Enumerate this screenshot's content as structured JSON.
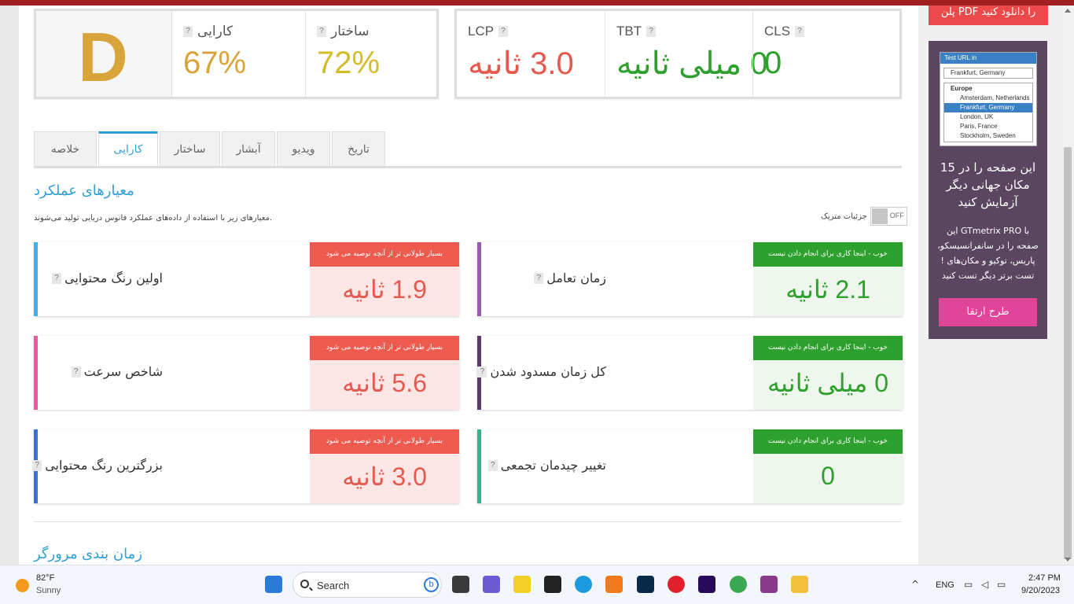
{
  "summary": {
    "grade": "D",
    "performance": {
      "label": "کارایی",
      "value": "67%",
      "color": "#d9a43a"
    },
    "structure": {
      "label": "ساختار",
      "value": "72%",
      "color": "#d4bb2a"
    }
  },
  "vitals": {
    "lcp": {
      "label": "LCP",
      "value": "3.0 ثانیه",
      "color": "#e55a4f"
    },
    "tbt": {
      "label": "TBT",
      "value": "0 میلی ثانیه",
      "color": "#2ea02e"
    },
    "cls": {
      "label": "CLS",
      "value": "0",
      "color": "#2ea02e"
    }
  },
  "help_mark": "?",
  "tabs": [
    "خلاصه",
    "کارایی",
    "ساختار",
    "آبشار",
    "ویدیو",
    "تاریخ"
  ],
  "active_tab": "کارایی",
  "metrics_section": {
    "title": "معیارهای عملکرد",
    "description": ".معیارهای زیر با استفاده از داده‌های عملکرد فانوس دریایی تولید می‌شوند",
    "toggle_label": "جزئیات متریک",
    "toggle_state": "OFF"
  },
  "metrics": [
    {
      "label": "زمان تعامل",
      "status": "خوب - اینجا کاری برای انجام دادن نیست",
      "value": "2.1 ثانیه",
      "type": "good",
      "bar_color": "#9b59b6"
    },
    {
      "label": "اولین رنگ محتوایی",
      "status": "بسیار طولانی تر از آنچه توصیه می شود",
      "value": "1.9 ثانیه",
      "type": "bad",
      "bar_color": "#35b5e8"
    },
    {
      "label": "کل زمان مسدود شدن",
      "status": "خوب - اینجا کاری برای انجام دادن نیست",
      "value": "0 میلی ثانیه",
      "type": "good",
      "bar_color": "#5b3a6e"
    },
    {
      "label": "شاخص سرعت",
      "status": "بسیار طولانی تر از آنچه توصیه می شود",
      "value": "5.6 ثانیه",
      "type": "bad",
      "bar_color": "#e85b9a"
    },
    {
      "label": "تغییر چیدمان تجمعی",
      "status": "خوب - اینجا کاری برای انجام دادن نیست",
      "value": "0",
      "type": "good",
      "bar_color": "#2fb58b"
    },
    {
      "label": "بزرگترین رنگ محتوایی",
      "status": "بسیار طولانی تر از آنچه توصیه می شود",
      "value": "3.0 ثانیه",
      "type": "bad",
      "bar_color": "#3a6fd0"
    }
  ],
  "browser_timing": {
    "title": "زمان بندی مرورگر"
  },
  "sidebar": {
    "pdf_button": "را دانلود کنید PDF پلن",
    "mini_form": {
      "header": "Test URL in",
      "selected": "Frankfurt, Germany",
      "group": "Europe",
      "options": [
        "Amsterdam, Netherlands",
        "Frankfurt, Germany",
        "London, UK",
        "Paris, France",
        "Stockholm, Sweden"
      ]
    },
    "promo_title": "این صفحه را در 15 مکان جهانی دیگر آزمایش کنید",
    "promo_body": "با GTmetrix PRO این صفحه را در سانفرانسیسکو، پاریس، توکیو و مکان‌های ! تست برتر دیگر تست کنید",
    "promo_cta": "طرح ارتقا"
  },
  "taskbar": {
    "weather_temp": "82°F",
    "weather_cond": "Sunny",
    "search_placeholder": "Search",
    "language": "ENG",
    "time": "2:47 PM",
    "date": "9/20/2023"
  }
}
